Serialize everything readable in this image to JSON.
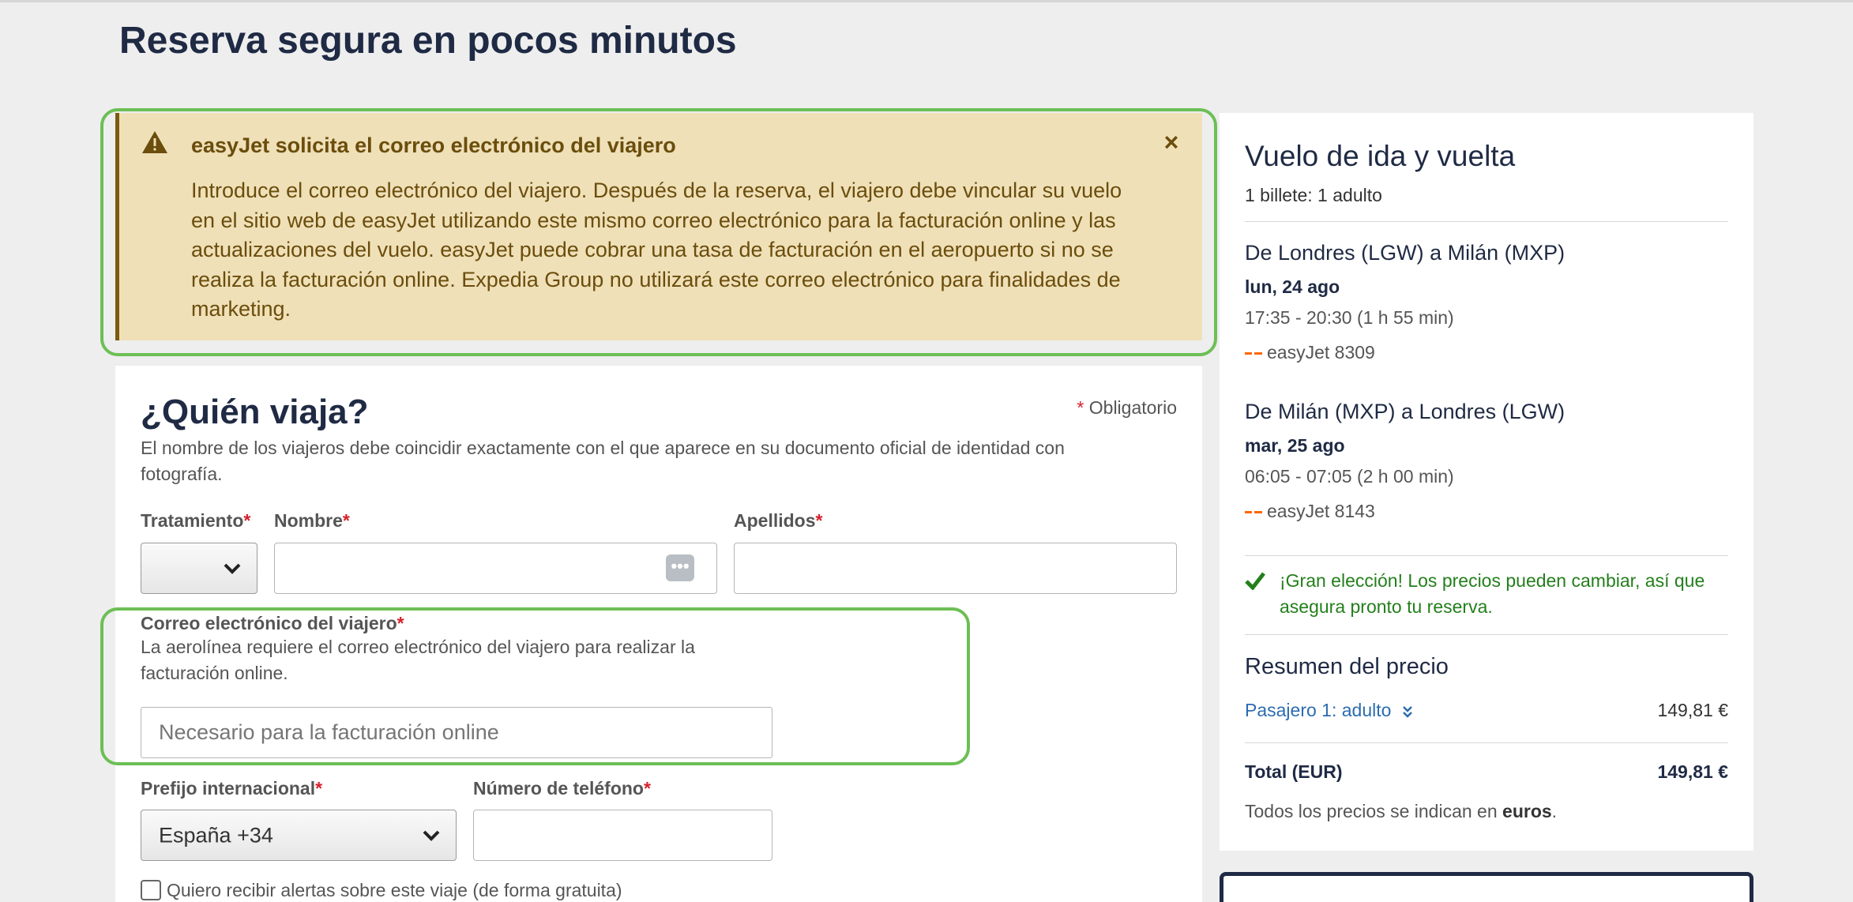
{
  "page": {
    "title": "Reserva segura en pocos minutos"
  },
  "alert": {
    "title": "easyJet solicita el correo electrónico del viajero",
    "body": "Introduce el correo electrónico del viajero. Después de la reserva, el viajero debe vincular su vuelo en el sitio web de easyJet utilizando este mismo correo electrónico para la facturación online y las actualizaciones del vuelo. easyJet puede cobrar una tasa de facturación en el aeropuerto si no se realiza la facturación online. Expedia Group no utilizará este correo electrónico para finalidades de marketing.",
    "icon": "warning-icon",
    "close_icon": "close-icon",
    "close_glyph": "×"
  },
  "form": {
    "title": "¿Quién viaja?",
    "required_star": "*",
    "required_note": "Obligatorio",
    "description": "El nombre de los viajeros debe coincidir exactamente con el que aparece en su documento oficial de identidad con fotografía.",
    "title_label": "Tratamiento",
    "title_value": "",
    "first_name_label": "Nombre",
    "first_name_value": "",
    "autofill_glyph": "•••",
    "last_name_label": "Apellidos",
    "last_name_value": "",
    "email_label": "Correo electrónico del viajero",
    "email_hint": "La aerolínea requiere el correo electrónico del viajero para realizar la facturación online.",
    "email_placeholder": "Necesario para la facturación online",
    "email_value": "",
    "prefix_label": "Prefijo internacional",
    "prefix_value": "España +34",
    "phone_label": "Número de teléfono",
    "phone_value": "",
    "alerts_checkbox_label": "Quiero recibir alertas sobre este viaje (de forma gratuita)",
    "alerts_checked": false
  },
  "summary": {
    "title": "Vuelo de ida y vuelta",
    "tickets": "1 billete: 1 adulto",
    "legs": [
      {
        "route": "De Londres (LGW) a Milán (MXP)",
        "date": "lun, 24 ago",
        "time": "17:35 - 20:30 (1 h 55 min)",
        "flight": "easyJet 8309"
      },
      {
        "route": "De Milán (MXP) a Londres (LGW)",
        "date": "mar, 25 ago",
        "time": "06:05 - 07:05 (2 h 00 min)",
        "flight": "easyJet 8143"
      }
    ],
    "good_choice": "¡Gran elección! Los precios pueden cambiar, así que asegura pronto tu reserva.",
    "price_title": "Resumen del precio",
    "passenger_link": "Pasajero 1: adulto",
    "passenger_price": "149,81 €",
    "total_label": "Total (EUR)",
    "total_price": "149,81 €",
    "note_prefix": "Todos los precios se indican en",
    "note_currency": "euros",
    "note_suffix": "."
  },
  "colors": {
    "brand_dark": "#1f2a44",
    "alert_bg": "#efe0b8",
    "alert_text": "#6b4d0c",
    "highlight": "#6cbf55",
    "success": "#237f1b",
    "link": "#2b6cb0",
    "required": "#d6202c"
  }
}
